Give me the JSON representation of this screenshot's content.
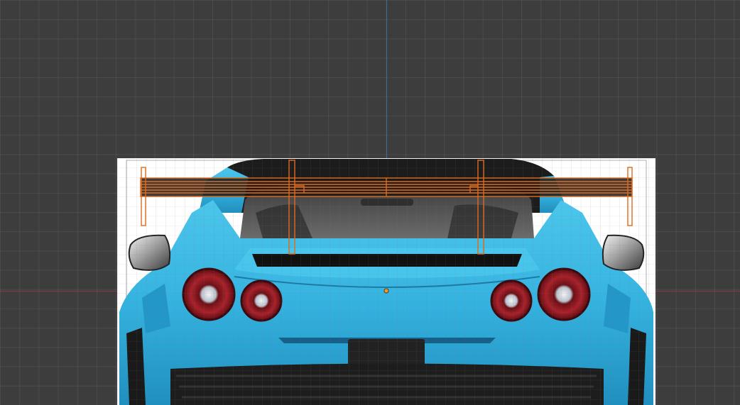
{
  "viewport": {
    "background": "#3d3d3d",
    "grid_color": "#4a4a4a",
    "x_axis_color": "#8b3a44",
    "y_axis_color": "#3d6e9a"
  },
  "reference_image": {
    "subject": "car-rear-view",
    "body_color": "#3ab8e0",
    "taillight_color": "#9e1a22"
  },
  "selection": {
    "object": "rear-wing",
    "outline_color": "#e06a1c",
    "origin_color": "#f0a030"
  }
}
